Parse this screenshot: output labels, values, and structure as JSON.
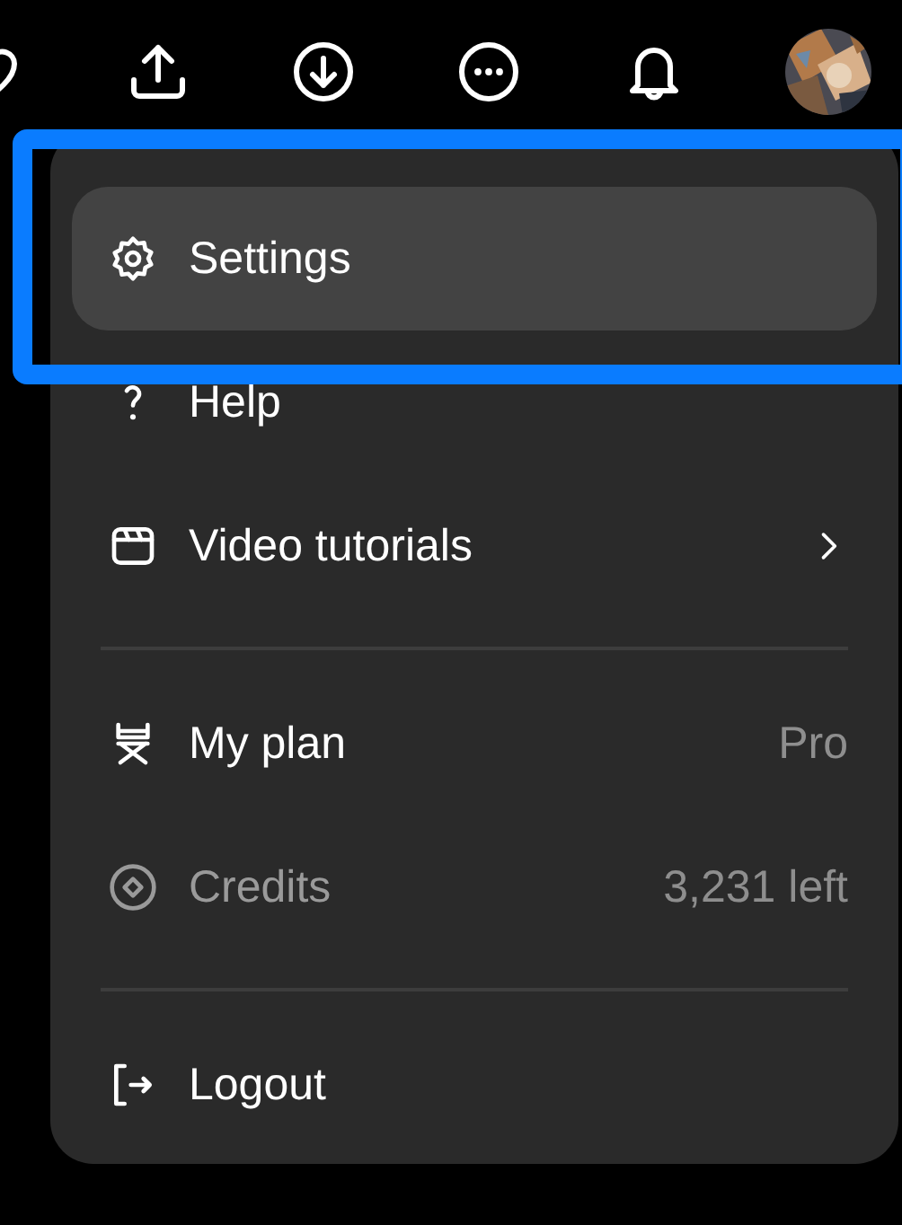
{
  "menu": {
    "sections": [
      [
        {
          "label": "Settings",
          "selected": true,
          "highlighted": true,
          "disabled": false,
          "submenu": false
        },
        {
          "label": "Help",
          "selected": false,
          "highlighted": false,
          "disabled": false,
          "submenu": false
        },
        {
          "label": "Video tutorials",
          "selected": false,
          "highlighted": false,
          "disabled": false,
          "submenu": true
        }
      ],
      [
        {
          "label": "My plan",
          "value": "Pro",
          "selected": false,
          "highlighted": false,
          "disabled": false,
          "submenu": false
        },
        {
          "label": "Credits",
          "value": "3,231 left",
          "selected": false,
          "highlighted": false,
          "disabled": true,
          "submenu": false
        }
      ],
      [
        {
          "label": "Logout",
          "selected": false,
          "highlighted": false,
          "disabled": false,
          "submenu": false
        }
      ]
    ]
  }
}
